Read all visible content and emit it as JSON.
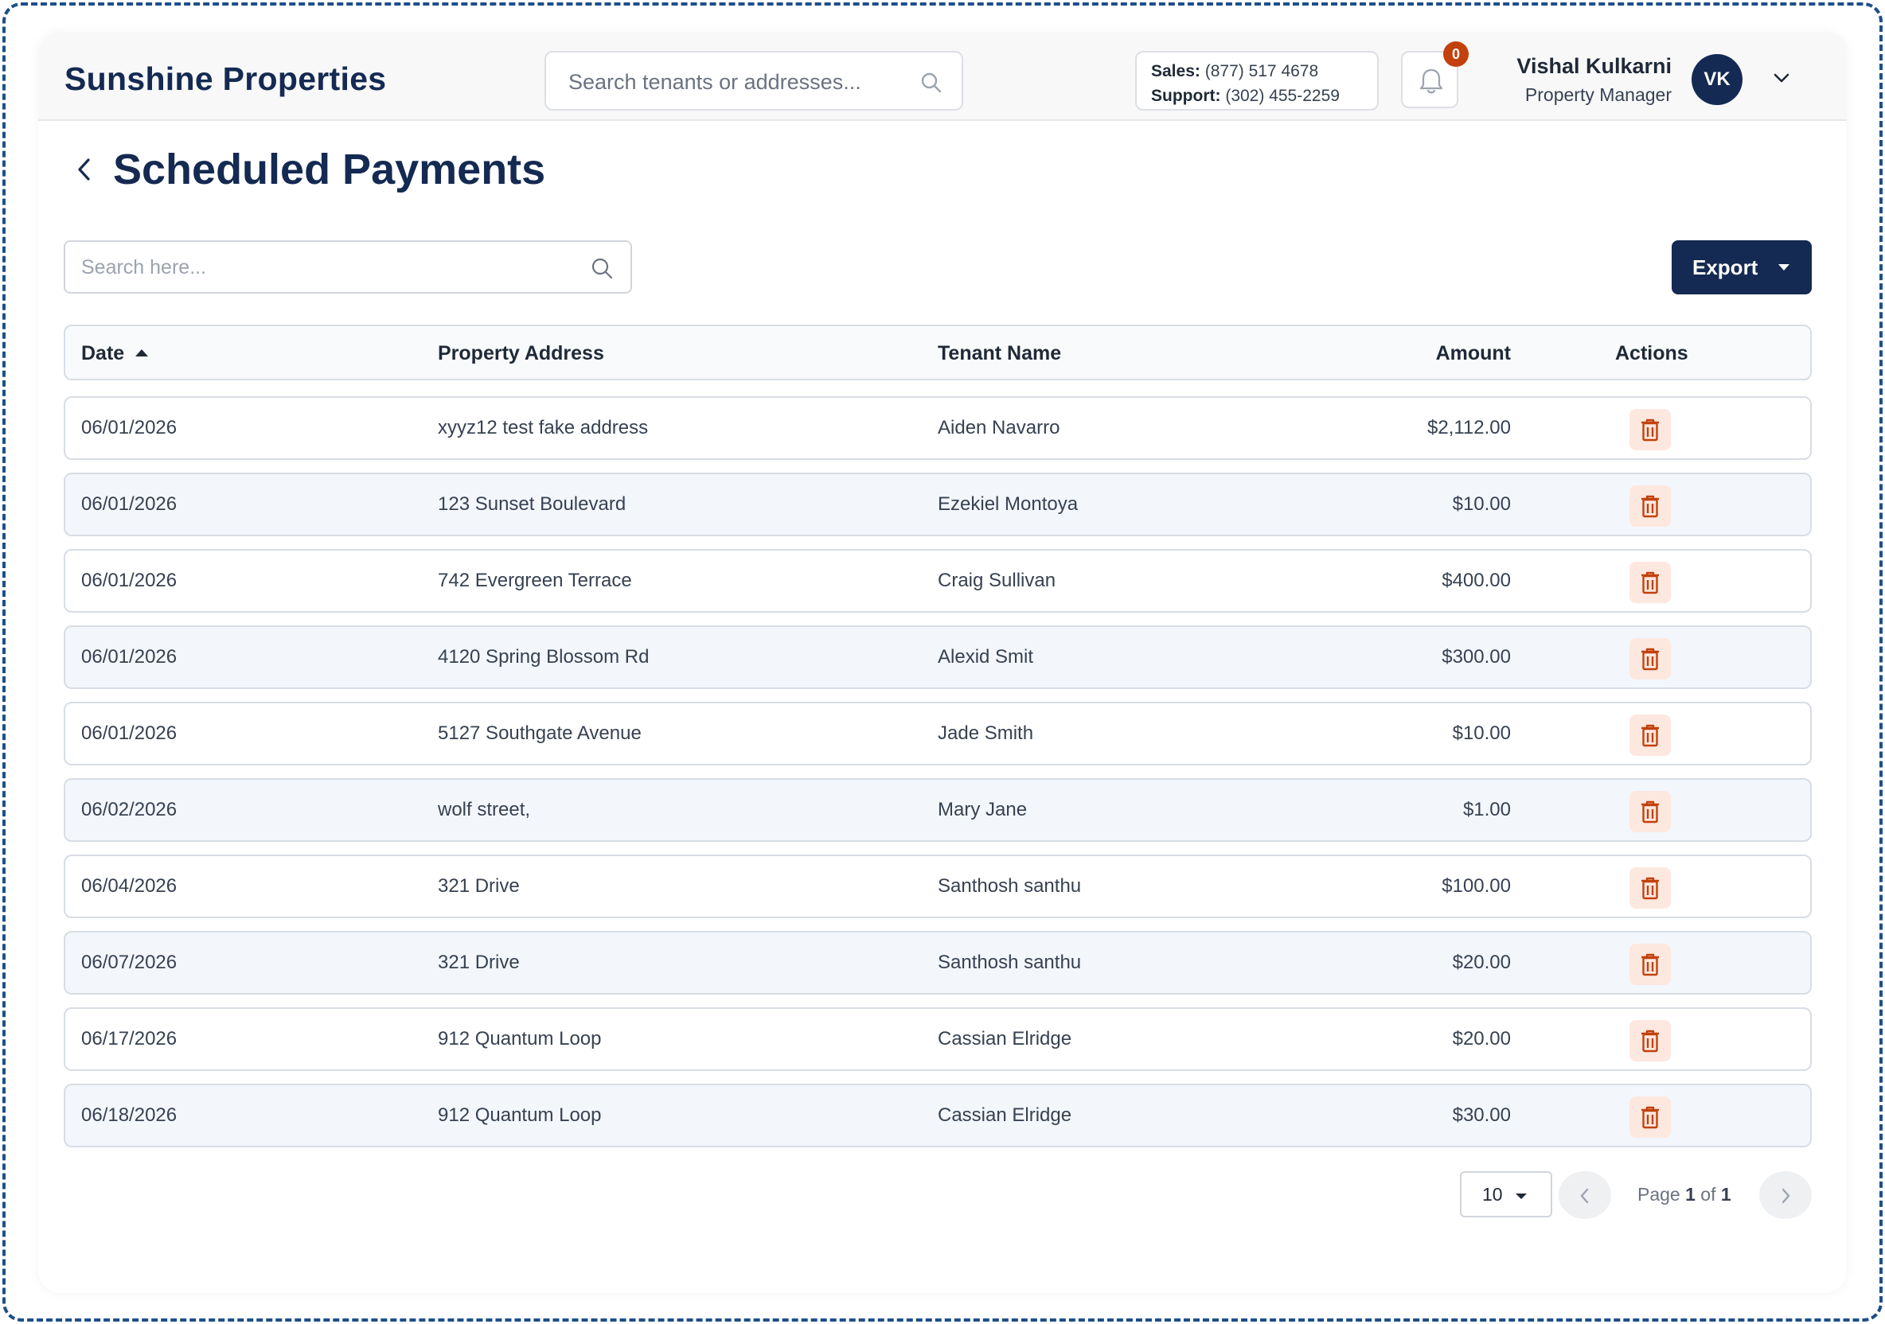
{
  "header": {
    "brand": "Sunshine Properties",
    "search_placeholder": "Search tenants or addresses...",
    "contact": {
      "sales_label": "Sales:",
      "sales_phone": "(877) 517 4678",
      "support_label": "Support:",
      "support_phone": "(302) 455-2259"
    },
    "notifications_count": "0",
    "user": {
      "name": "Vishal Kulkarni",
      "role": "Property Manager",
      "initials": "VK"
    }
  },
  "page": {
    "title": "Scheduled Payments",
    "search_placeholder": "Search here...",
    "export_label": "Export"
  },
  "table": {
    "columns": {
      "date": "Date",
      "address": "Property Address",
      "tenant": "Tenant Name",
      "amount": "Amount",
      "actions": "Actions"
    },
    "rows": [
      {
        "date": "06/01/2026",
        "address": "xyyz12 test fake address",
        "tenant": "Aiden Navarro",
        "amount": "$2,112.00"
      },
      {
        "date": "06/01/2026",
        "address": "123 Sunset Boulevard",
        "tenant": "Ezekiel Montoya",
        "amount": "$10.00"
      },
      {
        "date": "06/01/2026",
        "address": "742 Evergreen Terrace",
        "tenant": "Craig Sullivan",
        "amount": "$400.00"
      },
      {
        "date": "06/01/2026",
        "address": "4120 Spring Blossom Rd",
        "tenant": "Alexid Smit",
        "amount": "$300.00"
      },
      {
        "date": "06/01/2026",
        "address": "5127 Southgate Avenue",
        "tenant": "Jade Smith",
        "amount": "$10.00"
      },
      {
        "date": "06/02/2026",
        "address": "wolf street,",
        "tenant": "Mary Jane",
        "amount": "$1.00"
      },
      {
        "date": "06/04/2026",
        "address": "321 Drive",
        "tenant": "Santhosh santhu",
        "amount": "$100.00"
      },
      {
        "date": "06/07/2026",
        "address": "321 Drive",
        "tenant": "Santhosh santhu",
        "amount": "$20.00"
      },
      {
        "date": "06/17/2026",
        "address": "912 Quantum Loop",
        "tenant": "Cassian Elridge",
        "amount": "$20.00"
      },
      {
        "date": "06/18/2026",
        "address": "912 Quantum Loop",
        "tenant": "Cassian Elridge",
        "amount": "$30.00"
      }
    ]
  },
  "pagination": {
    "per_page": "10",
    "page_word": "Page",
    "current": "1",
    "of_word": "of",
    "total": "1"
  },
  "colors": {
    "brand_navy": "#142a52",
    "delete_icon": "#c2410c",
    "delete_bg": "#fde8df",
    "row_alt_bg": "#f3f7fc"
  },
  "icons": {
    "search": "search-icon",
    "bell": "bell-icon",
    "back": "chevron-left-icon",
    "delete": "trash-icon"
  }
}
